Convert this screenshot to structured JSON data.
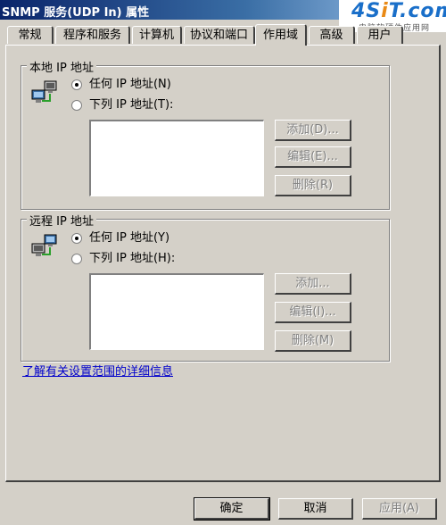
{
  "window": {
    "title": "SNMP 服务(UDP In) 属性"
  },
  "watermark": {
    "brand": "4Sit.com",
    "subtitle": "电脑软硬件应用网"
  },
  "tabs": [
    "常规",
    "程序和服务",
    "计算机",
    "协议和端口",
    "作用域",
    "高级",
    "用户"
  ],
  "active_tab": "作用域",
  "local": {
    "legend": "本地 IP 地址",
    "any_label": "任何 IP 地址(N)",
    "list_label": "下列 IP 地址(T):",
    "add": "添加(D)...",
    "edit": "编辑(E)...",
    "delete": "删除(R)"
  },
  "remote": {
    "legend": "远程 IP 地址",
    "any_label": "任何 IP 地址(Y)",
    "list_label": "下列 IP 地址(H):",
    "add": "添加...",
    "edit": "编辑(I)...",
    "delete": "删除(M)"
  },
  "help_link": "了解有关设置范围的详细信息",
  "footer": {
    "ok": "确定",
    "cancel": "取消",
    "apply": "应用(A)"
  }
}
